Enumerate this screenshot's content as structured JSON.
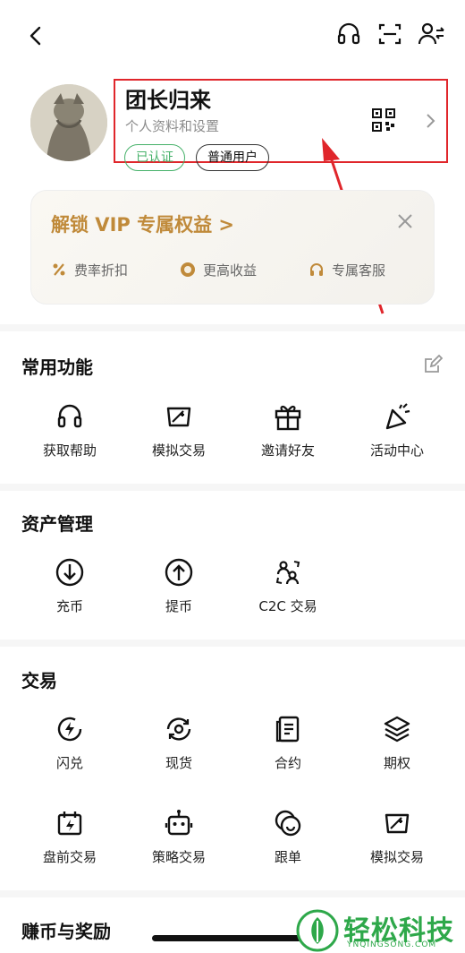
{
  "profile": {
    "username": "团长归来",
    "subtitle": "个人资料和设置",
    "badges": {
      "verified": "已认证",
      "tier": "普通用户"
    }
  },
  "vip": {
    "title": "解锁 VIP 专属权益  >",
    "benefits": [
      "费率折扣",
      "更高收益",
      "专属客服"
    ]
  },
  "sections": {
    "common": {
      "title": "常用功能",
      "items": [
        {
          "label": "获取帮助",
          "icon": "headset-icon"
        },
        {
          "label": "模拟交易",
          "icon": "demo-trade-icon"
        },
        {
          "label": "邀请好友",
          "icon": "gift-icon"
        },
        {
          "label": "活动中心",
          "icon": "party-popper-icon"
        }
      ]
    },
    "assets": {
      "title": "资产管理",
      "items": [
        {
          "label": "充币",
          "icon": "deposit-icon"
        },
        {
          "label": "提币",
          "icon": "withdraw-icon"
        },
        {
          "label": "C2C 交易",
          "icon": "c2c-icon"
        }
      ]
    },
    "trade": {
      "title": "交易",
      "items": [
        {
          "label": "闪兑",
          "icon": "flash-convert-icon"
        },
        {
          "label": "现货",
          "icon": "spot-icon"
        },
        {
          "label": "合约",
          "icon": "contract-icon"
        },
        {
          "label": "期权",
          "icon": "options-icon"
        },
        {
          "label": "盘前交易",
          "icon": "premarket-icon"
        },
        {
          "label": "策略交易",
          "icon": "bot-icon"
        },
        {
          "label": "跟单",
          "icon": "copy-trade-icon"
        },
        {
          "label": "模拟交易",
          "icon": "demo-trade-icon"
        }
      ]
    },
    "earn": {
      "title": "赚币与奖励"
    }
  },
  "watermark": {
    "text": "轻松科技",
    "sub": "YNQINGSONG.COM"
  },
  "colors": {
    "accent_gold": "#c08a3a",
    "verified_green": "#45b169",
    "annotation_red": "#e0262b"
  }
}
